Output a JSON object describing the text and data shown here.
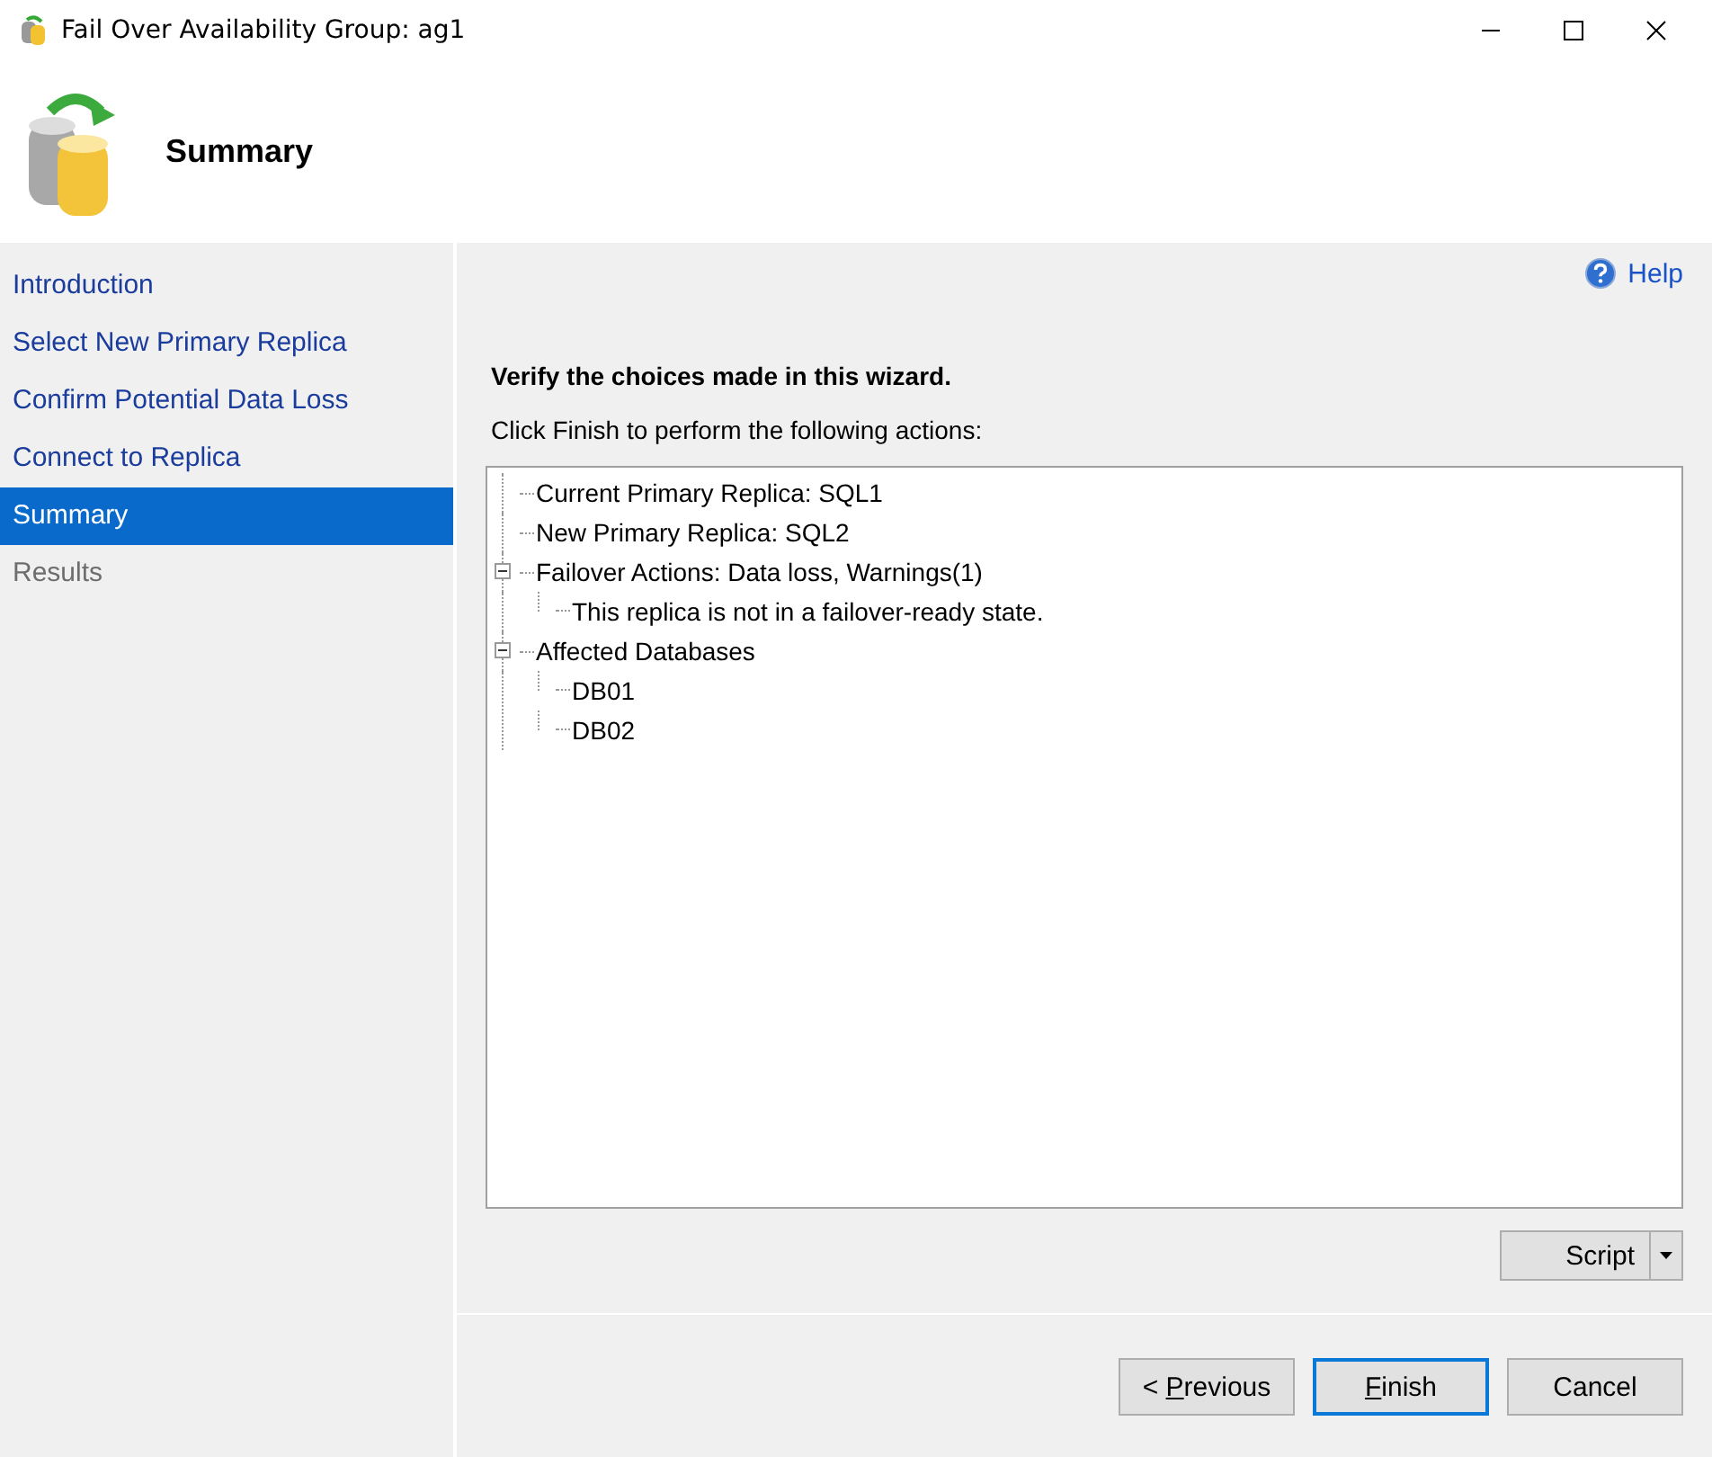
{
  "window": {
    "title": "Fail Over Availability Group: ag1"
  },
  "header": {
    "title": "Summary"
  },
  "sidebar": {
    "items": [
      {
        "label": "Introduction",
        "selected": false,
        "disabled": false
      },
      {
        "label": "Select New Primary Replica",
        "selected": false,
        "disabled": false
      },
      {
        "label": "Confirm Potential Data Loss",
        "selected": false,
        "disabled": false
      },
      {
        "label": "Connect to Replica",
        "selected": false,
        "disabled": false
      },
      {
        "label": "Summary",
        "selected": true,
        "disabled": false
      },
      {
        "label": "Results",
        "selected": false,
        "disabled": true
      }
    ]
  },
  "help": {
    "label": "Help"
  },
  "heading": "Verify the choices made in this wizard.",
  "instruction": "Click Finish to perform the following actions:",
  "tree": [
    {
      "label": "Current Primary Replica: SQL1"
    },
    {
      "label": "New Primary Replica: SQL2"
    },
    {
      "label": "Failover Actions: Data loss, Warnings(1)",
      "expanded": true,
      "children": [
        {
          "label": "This replica is not in a failover-ready state."
        }
      ]
    },
    {
      "label": "Affected Databases",
      "expanded": true,
      "children": [
        {
          "label": "DB01"
        },
        {
          "label": "DB02"
        }
      ]
    }
  ],
  "script_button": {
    "label": "Script"
  },
  "buttons": [
    {
      "before": "< ",
      "key": "P",
      "after": "revious",
      "default": false
    },
    {
      "key": "F",
      "after": "inish",
      "default": true
    },
    {
      "before": "Cancel",
      "default": false
    }
  ]
}
